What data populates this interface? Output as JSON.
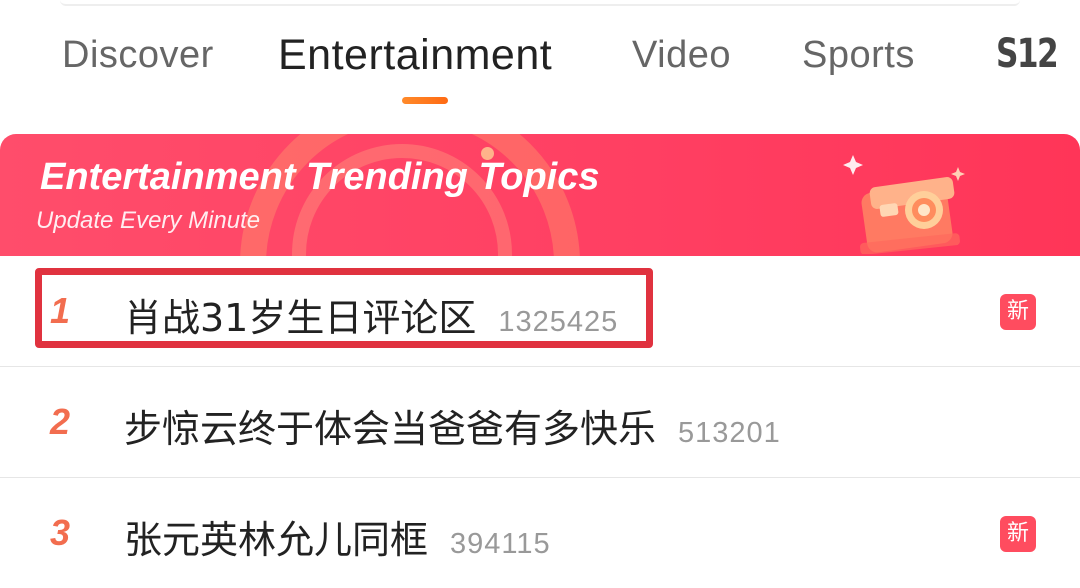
{
  "tabs": [
    {
      "label": "Discover",
      "active": false
    },
    {
      "label": "Entertainment",
      "active": true
    },
    {
      "label": "Video",
      "active": false
    },
    {
      "label": "Sports",
      "active": false
    },
    {
      "label": "S12",
      "active": false
    }
  ],
  "banner": {
    "title": "Entertainment Trending Topics",
    "subtitle": "Update Every Minute",
    "icon": "camera-icon"
  },
  "topics": [
    {
      "rank": "1",
      "title": "肖战31岁生日评论区",
      "count": "1325425",
      "badge": "新",
      "highlighted": true
    },
    {
      "rank": "2",
      "title": "步惊云终于体会当爸爸有多快乐",
      "count": "513201",
      "badge": "",
      "highlighted": false
    },
    {
      "rank": "3",
      "title": "张元英林允儿同框",
      "count": "394115",
      "badge": "新",
      "highlighted": false
    }
  ],
  "colors": {
    "accent": "#ff6a13",
    "banner": "#ff3f62",
    "rank": "#f26d4f",
    "badge": "#ff4c5f",
    "highlight_box": "#e0323f"
  }
}
